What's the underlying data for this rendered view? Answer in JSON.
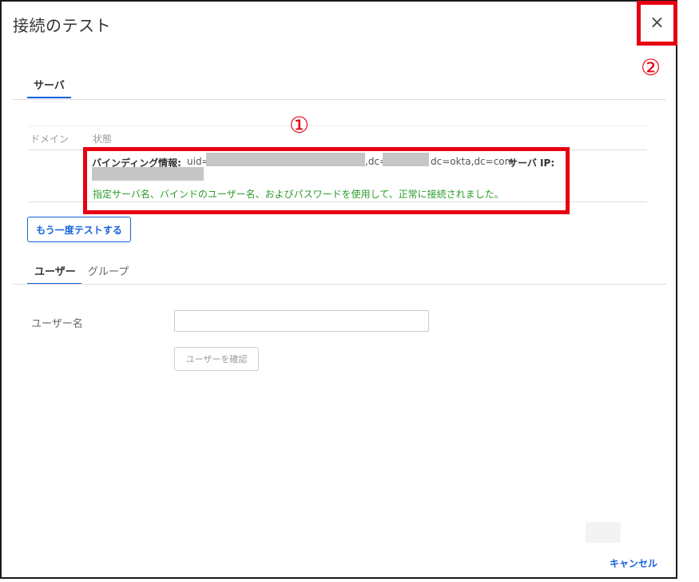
{
  "dialog": {
    "title": "接続のテスト",
    "close_glyph": "×"
  },
  "annotations": {
    "marker1": "①",
    "marker2": "②",
    "highlight_color": "#e60012"
  },
  "server_tab": {
    "label": "サーバ"
  },
  "result_table": {
    "columns": [
      "ドメイン",
      "状態"
    ],
    "binding_label": "バインディング情報:",
    "binding_uid_prefix": "uid=",
    "binding_dc_prefix": ",dc=",
    "binding_dc_suffix": "dc=okta,dc=com",
    "server_ip_label": "サーバ IP:",
    "success_message": "指定サーバ名、バインドのユーザー名、およびパスワードを使用して、正常に接続されました。"
  },
  "retest_button": {
    "label": "もう一度テストする"
  },
  "sub_tabs": [
    {
      "label": "ユーザー",
      "active": true
    },
    {
      "label": "グループ",
      "active": false
    }
  ],
  "user_form": {
    "username_label": "ユーザー名",
    "username_value": "",
    "confirm_button": "ユーザーを確認"
  },
  "footer": {
    "cancel_label": "キャンセル"
  },
  "colors": {
    "accent": "#1662dd",
    "success": "#2c9c2c"
  }
}
